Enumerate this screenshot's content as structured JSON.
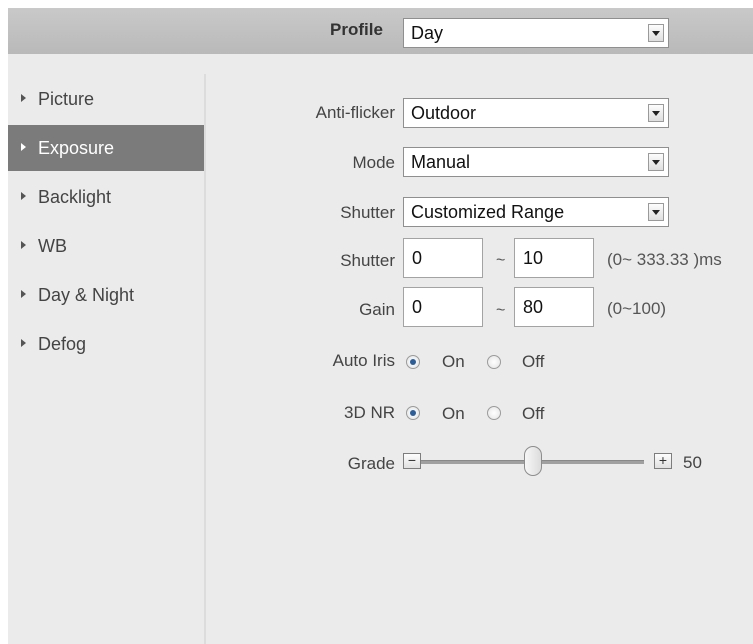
{
  "profile": {
    "label": "Profile",
    "value": "Day"
  },
  "sidebar": {
    "items": [
      {
        "label": "Picture",
        "active": false
      },
      {
        "label": "Exposure",
        "active": true
      },
      {
        "label": "Backlight",
        "active": false
      },
      {
        "label": "WB",
        "active": false
      },
      {
        "label": "Day & Night",
        "active": false
      },
      {
        "label": "Defog",
        "active": false
      }
    ]
  },
  "form": {
    "anti_flicker": {
      "label": "Anti-flicker",
      "value": "Outdoor"
    },
    "mode": {
      "label": "Mode",
      "value": "Manual"
    },
    "shutter_type": {
      "label": "Shutter",
      "value": "Customized Range"
    },
    "shutter_range": {
      "label": "Shutter",
      "min": "0",
      "sep": "~",
      "max": "10",
      "hint": "(0~ 333.33 )ms"
    },
    "gain": {
      "label": "Gain",
      "min": "0",
      "sep": "~",
      "max": "80",
      "hint": "(0~100)"
    },
    "auto_iris": {
      "label": "Auto Iris",
      "on": "On",
      "off": "Off",
      "selected": "On"
    },
    "nr3d": {
      "label": "3D NR",
      "on": "On",
      "off": "Off",
      "selected": "On"
    },
    "grade": {
      "label": "Grade",
      "minus": "−",
      "plus": "+",
      "value": "50",
      "level": 0.5
    }
  }
}
